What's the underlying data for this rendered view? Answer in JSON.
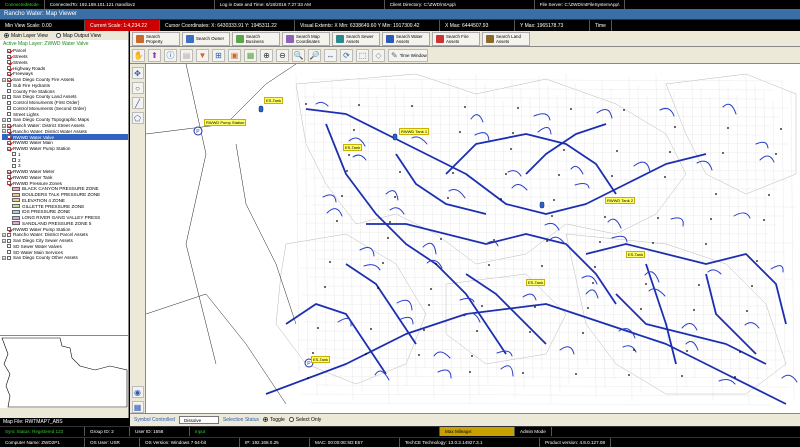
{
  "topbar": {
    "mode": "ConnectedMode",
    "connection": "ConnectedTo: 192.169.101.121 rsandlov2",
    "login": "Log in Date and Time: 6/18/2016 7:27:33 AM",
    "client_dir": "Client Directory: C:\\ZWD\\mtApp\\",
    "file_server": "File Server: C:\\ZWD\\mtFileSystemApp\\"
  },
  "window_title": "Rancho Water: Map Viewer",
  "status1": {
    "min_view_scale": "Min View Scale: 0.00",
    "current_scale": "Current Scale: 1:4,234.22",
    "cursor_coords": "Cursor Coordinates: X: 6430333.91  Y: 1945311.22",
    "visual_extents": "Visual Extents:  X Min: 6338649.60  Y Min: 1917300.42",
    "x_max": "X Max: 6444507.93",
    "y_max": "Y Max: 1965178.73",
    "time": "Time"
  },
  "view_options": {
    "main_layer_view": "Main Layer View",
    "map_output_view": "Map Output View"
  },
  "active_map_layer": "Active Map Layer: ZWWD Water Valve",
  "layers": [
    {
      "label": "Parcel",
      "indent": 1,
      "check": true
    },
    {
      "label": "Streets",
      "indent": 1,
      "check": true
    },
    {
      "label": "Streets",
      "indent": 1,
      "check": true
    },
    {
      "label": "Highway Roads",
      "indent": 1,
      "check": true
    },
    {
      "label": "Freeways",
      "indent": 1,
      "check": true
    },
    {
      "label": "San Diego County Fire Assets",
      "indent": 0,
      "check": true,
      "expander": true
    },
    {
      "label": "Sub Fire Hydrants",
      "indent": 1,
      "check": false
    },
    {
      "label": "County Fire Stations",
      "indent": 1,
      "check": false
    },
    {
      "label": "San Diego County Land Assets",
      "indent": 0,
      "check": false,
      "expander": true
    },
    {
      "label": "Control Monuments (First Order)",
      "indent": 1,
      "check": false
    },
    {
      "label": "Control Monuments (Second Order)",
      "indent": 1,
      "check": false
    },
    {
      "label": "Street Lights",
      "indent": 1,
      "check": false
    },
    {
      "label": "San Diego County Topographic Maps",
      "indent": 0,
      "check": false,
      "expander": true
    },
    {
      "label": "Ranch Water: District Street Assets",
      "indent": 0,
      "check": true,
      "expander": true
    },
    {
      "label": "Rancho Water: District Water Assets",
      "indent": 0,
      "check": true,
      "expander": true
    },
    {
      "label": "RWWD Water Valve",
      "indent": 1,
      "check": true,
      "selected": true
    },
    {
      "label": "RWWD Water Main",
      "indent": 1,
      "check": true
    },
    {
      "label": "RWWD Water Pump Station",
      "indent": 1,
      "check": true
    },
    {
      "label": "1",
      "indent": 2,
      "check": false
    },
    {
      "label": "2",
      "indent": 2,
      "check": false
    },
    {
      "label": "3",
      "indent": 2,
      "check": false
    },
    {
      "label": "RWWD Water Meter",
      "indent": 1,
      "check": true
    },
    {
      "label": "RWWD Water Tank",
      "indent": 1,
      "check": true
    },
    {
      "label": "RWWD Pressure Zones",
      "indent": 1,
      "check": true
    },
    {
      "label": "BLACK CANYON PRESSURE ZONE",
      "indent": 2,
      "swatch": "#f4a0b8"
    },
    {
      "label": "BOULDERS TALK PRESSURE ZONE",
      "indent": 2,
      "swatch": "#f6c0a0"
    },
    {
      "label": "ELEVATION 4 ZONE",
      "indent": 2,
      "swatch": "#f0d080"
    },
    {
      "label": "GILLETTE PRESSURE ZONE",
      "indent": 2,
      "swatch": "#c0e0a0"
    },
    {
      "label": "IDS PRESSURE ZONE",
      "indent": 2,
      "swatch": "#a0d0f0"
    },
    {
      "label": "LONG RIVER GANG VALLEY PRESS",
      "indent": 2,
      "swatch": "#c8b0e8"
    },
    {
      "label": "SANDLAND PRESSURE ZONE 5",
      "indent": 2,
      "swatch": "#e8a8d0"
    },
    {
      "label": "RWWD Water Pump Station",
      "indent": 1,
      "check": true
    },
    {
      "label": "Rancho Water: District Parcel Assets",
      "indent": 0,
      "check": false,
      "expander": true
    },
    {
      "label": "San Diego City Sewer Assets",
      "indent": 0,
      "check": false,
      "expander": true
    },
    {
      "label": "SD Sewer Water Valves",
      "indent": 1,
      "check": false
    },
    {
      "label": "SD Water Main Services",
      "indent": 1,
      "check": false
    },
    {
      "label": "San Diego County Other Assets",
      "indent": 0,
      "check": false,
      "expander": true
    }
  ],
  "map_file": "Map File: RWTMAP7_ABS",
  "toolbar": [
    {
      "label": "Search Property",
      "icon": "#c96a2c"
    },
    {
      "label": "Search Owner",
      "icon": "#3b6fc5"
    },
    {
      "label": "Search Business",
      "icon": "#5aa44a"
    },
    {
      "label": "Search Map Coordinates",
      "icon": "#8a63b5"
    },
    {
      "label": "Search Sewer Assets",
      "icon": "#2a8a8a"
    },
    {
      "label": "Search Water Assets",
      "icon": "#2a5ab3"
    },
    {
      "label": "Search Fire Assets",
      "icon": "#c33"
    },
    {
      "label": "Search Land Assets",
      "icon": "#8a6a2a"
    }
  ],
  "toolbar2_extra": {
    "label": "Time Window"
  },
  "map_labels": [
    {
      "text": "ES-Tank"
    },
    {
      "text": "RWWD Pump Station"
    },
    {
      "text": "RWWD Tank 1"
    },
    {
      "text": "ES-Tank"
    },
    {
      "text": "RWWD Tank 2"
    },
    {
      "text": "ES-Tank"
    },
    {
      "text": "ES-Tank"
    },
    {
      "text": "ES-Tank"
    }
  ],
  "bottom": {
    "symbol_controlled": "Symbol Controlled",
    "tool_select": "Dissolve",
    "selection_status": "Selection Status",
    "toggle": "Toggle",
    "select_only": "Select Only"
  },
  "status2": {
    "sync_status": "Sync Status: Registered 123",
    "group": "Group ID: 2",
    "user_id": "User ID: 1558",
    "pending": "Input",
    "max_mileage": "Max Mileage:",
    "admin_mode": "Admin Mode"
  },
  "status3": {
    "computer": "Computer Name: ZWD2P1",
    "os_user": "OS User: USR",
    "os_version": "OS Version: Windows 7 64-bit",
    "ip": "IP: 192.168.0.25",
    "mac": "MAC: 00:00:0E:5D:E57",
    "tech": "TechCE Technology: 13.0.3.14927.3.1",
    "product": "Product version: 4.8.0.127.08"
  }
}
